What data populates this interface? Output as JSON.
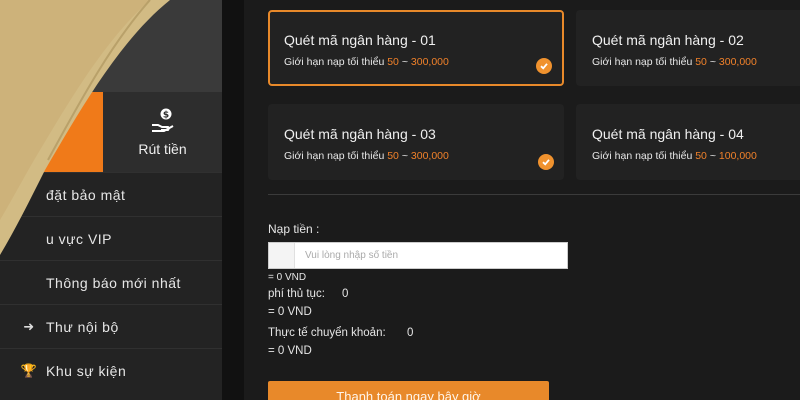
{
  "sidebar": {
    "tabs": [
      {
        "label": ""
      },
      {
        "label": "Rút tiền",
        "icon": "hand-money-icon"
      }
    ],
    "menu": [
      {
        "label": "đặt bảo mật",
        "icon": ""
      },
      {
        "label": "u vực VIP",
        "icon": ""
      },
      {
        "label": "Thông báo mới nhất",
        "icon": ""
      },
      {
        "label": "Thư nội bộ",
        "icon": "arrow-right-icon"
      },
      {
        "label": "Khu sự kiện",
        "icon": "trophy-icon"
      }
    ]
  },
  "channels": [
    {
      "title": "Quét mã ngân hàng - 01",
      "limit_prefix": "Giới hạn nạp tối thiểu",
      "min": "50",
      "sep": "~",
      "max": "300,000",
      "selected": true,
      "checked": true
    },
    {
      "title": "Quét mã ngân hàng - 02",
      "limit_prefix": "Giới hạn nạp tối thiểu",
      "min": "50",
      "sep": "~",
      "max": "300,000",
      "selected": false,
      "checked": false
    },
    {
      "title": "Quét mã ngân hàng - 03",
      "limit_prefix": "Giới hạn nạp tối thiểu",
      "min": "50",
      "sep": "~",
      "max": "300,000",
      "selected": false,
      "checked": true
    },
    {
      "title": "Quét mã ngân hàng - 04",
      "limit_prefix": "Giới hạn nạp tối thiểu",
      "min": "50",
      "sep": "~",
      "max": "100,000",
      "selected": false,
      "checked": false
    }
  ],
  "form": {
    "deposit_label": "Nạp tiền :",
    "amount_placeholder": "Vui lòng nhập số tiền",
    "amount_value": "",
    "amount_converted": "= 0 VND",
    "fee_label": "phí thủ tục:",
    "fee_value": "0",
    "fee_converted": "= 0 VND",
    "actual_label": "Thực tế chuyển khoản:",
    "actual_value": "0",
    "actual_converted": "= 0 VND",
    "pay_button": "Thanh toán ngay bây giờ"
  },
  "colors": {
    "accent": "#e8892a",
    "background": "#1b1b1b",
    "card": "#222222",
    "highlight_number": "#f0812a"
  }
}
